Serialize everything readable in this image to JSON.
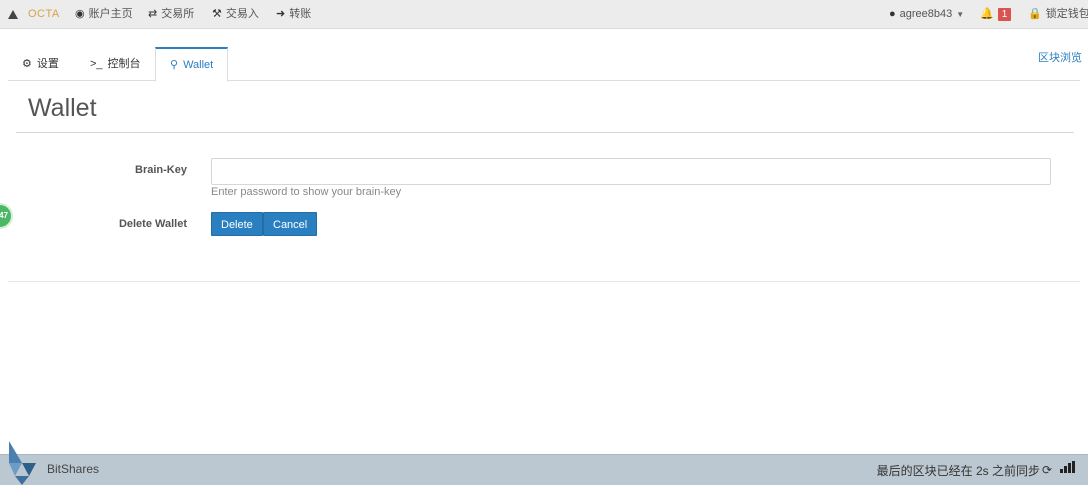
{
  "topnav": {
    "brand": "OCTA",
    "account_home": "账户主页",
    "exchange": "交易所",
    "trade": "交易入",
    "transfer": "转账",
    "account_name": "agree8b43",
    "notification_count": "1",
    "lock_wallet": "锁定钱包"
  },
  "tabs": [
    {
      "label": "设置"
    },
    {
      "label": "控制台"
    },
    {
      "label": "Wallet"
    }
  ],
  "explorer_link": "区块浏览",
  "page": {
    "title": "Wallet"
  },
  "form": {
    "brainkey_label": "Brain-Key",
    "brainkey_value": "",
    "brainkey_help": "Enter password to show your brain-key",
    "delete_wallet_label": "Delete Wallet",
    "delete_button": "Delete",
    "cancel_button": "Cancel"
  },
  "side_chip": "47",
  "footer": {
    "app_name": "BitShares",
    "sync_status": "最后的区块已经在 2s 之前同步"
  },
  "colors": {
    "accent": "#2a7fc1",
    "brand": "#d6a44a",
    "footer_bg": "#bcc8d1",
    "badge": "#d9534f"
  }
}
